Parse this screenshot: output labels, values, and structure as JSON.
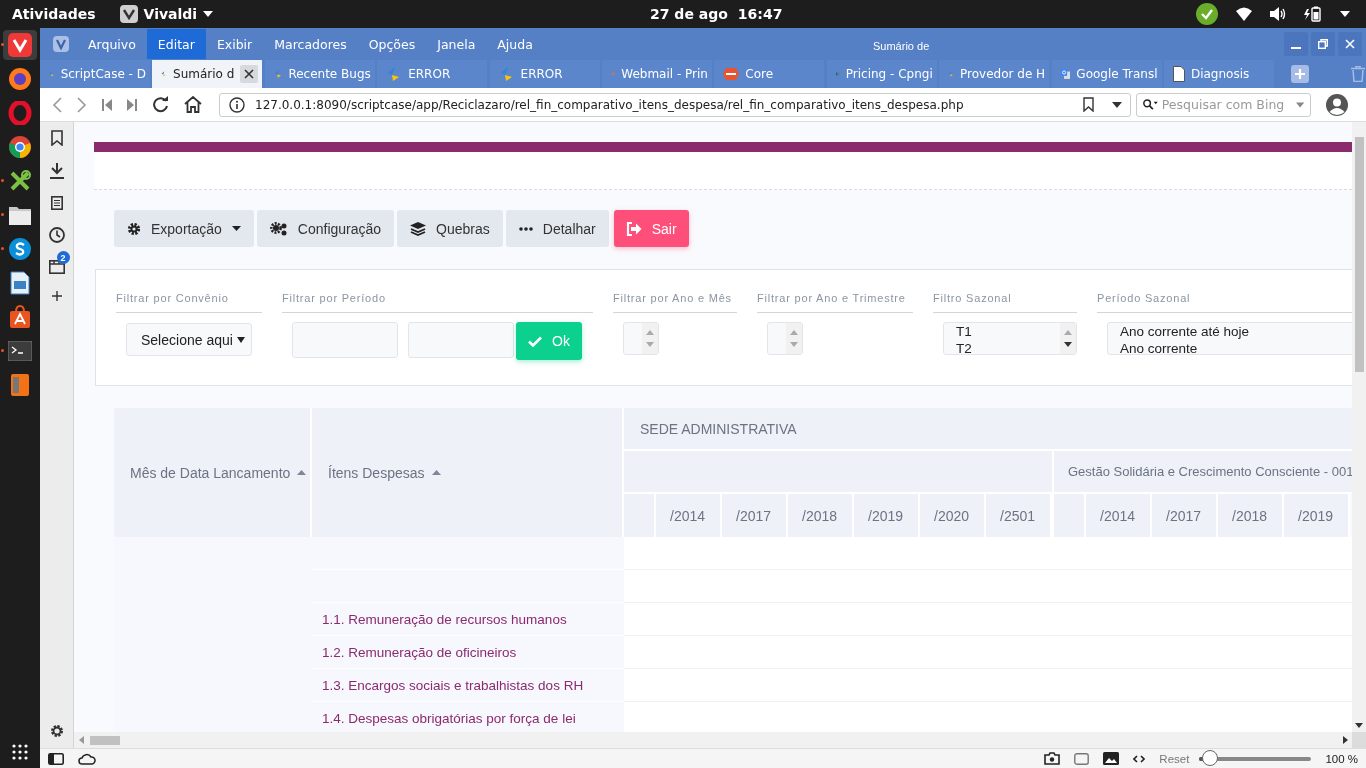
{
  "topbar": {
    "activities": "Atividades",
    "app": "Vivaldi",
    "date": "27 de ago",
    "time": "16:47"
  },
  "dock": [
    {
      "running": true,
      "selected": true
    },
    {
      "running": false,
      "selected": false
    },
    {
      "running": false,
      "selected": false
    },
    {
      "running": false,
      "selected": false
    },
    {
      "running": true,
      "selected": false
    },
    {
      "running": true,
      "selected": false
    },
    {
      "running": true,
      "selected": false
    },
    {
      "running": false,
      "selected": false
    },
    {
      "running": false,
      "selected": false
    },
    {
      "running": true,
      "selected": false
    },
    {
      "running": false,
      "selected": false
    }
  ],
  "browser": {
    "menu": [
      {
        "label": "Arquivo",
        "selected": false
      },
      {
        "label": "Editar",
        "selected": true
      },
      {
        "label": "Exibir",
        "selected": false
      },
      {
        "label": "Marcadores",
        "selected": false
      },
      {
        "label": "Opções",
        "selected": false
      },
      {
        "label": "Janela",
        "selected": false
      },
      {
        "label": "Ajuda",
        "selected": false
      }
    ],
    "window_title": "Sumário de",
    "tabs": [
      {
        "title": "ScriptCase - D",
        "selected": false
      },
      {
        "title": "Sumário d",
        "selected": true
      },
      {
        "title": "Recente Bugs",
        "selected": false
      },
      {
        "title": "ERROR",
        "selected": false
      },
      {
        "title": "ERROR",
        "selected": false
      },
      {
        "title": "Webmail - Prin",
        "selected": false
      },
      {
        "title": "Core",
        "selected": false
      },
      {
        "title": "Pricing - Cpngi",
        "selected": false
      },
      {
        "title": "Provedor de H",
        "selected": false
      },
      {
        "title": "Google Transl",
        "selected": false
      },
      {
        "title": "Diagnosis",
        "selected": false
      }
    ],
    "url": "127.0.0.1:8090/scriptcase/app/Reciclazaro/rel_fin_comparativo_itens_despesa/rel_fin_comparativo_itens_despesa.php",
    "search_placeholder": "Pesquisar com Bing",
    "panel_badge": "2",
    "zoom_reset": "Reset",
    "zoom": {
      "level": 0.1
    },
    "zoom_text": "100 %"
  },
  "page": {
    "toolbar": [
      {
        "label": "Exportação",
        "kind": "dropdown"
      },
      {
        "label": "Configuração",
        "kind": "plain"
      },
      {
        "label": "Quebras",
        "kind": "plain"
      },
      {
        "label": "Detalhar",
        "kind": "plain"
      },
      {
        "label": "Sair",
        "kind": "danger"
      }
    ],
    "filters": [
      {
        "label": "Filtrar por Convênio",
        "kind": "select",
        "value": "Selecione aqui"
      },
      {
        "label": "Filtrar por Período",
        "kind": "range",
        "button": "Ok"
      },
      {
        "label": "Filtrar por Ano e Mês",
        "kind": "spinner"
      },
      {
        "label": "Filtrar por Ano e Trimestre",
        "kind": "spinner"
      },
      {
        "label": "Filtro Sazonal",
        "kind": "listbox",
        "options": [
          "T1",
          "T2"
        ]
      },
      {
        "label": "Período Sazonal",
        "kind": "listbox",
        "options": [
          "Ano corrente até hoje",
          "Ano corrente"
        ]
      }
    ],
    "table": {
      "columns": [
        {
          "label": "Mês de Data Lancamento",
          "sorted": true
        },
        {
          "label": "Ítens Despesas",
          "sorted": true
        }
      ],
      "group": "SEDE ADMINISTRATIVA",
      "subgroups": [
        {
          "years": [
            "/2014",
            "/2017",
            "/2018",
            "/2019",
            "/2020",
            "/2501"
          ]
        },
        {
          "label": "Gestão Solidária e Crescimento Consciente - 001",
          "years": [
            "/2014",
            "/2017",
            "/2018",
            "/2019"
          ]
        }
      ],
      "items": [
        "1.1. Remuneração de recursos humanos",
        "1.2. Remuneração de oficineiros",
        "1.3. Encargos sociais e trabalhistas dos RH",
        "1.4. Despesas obrigatórias por força de lei"
      ]
    }
  }
}
